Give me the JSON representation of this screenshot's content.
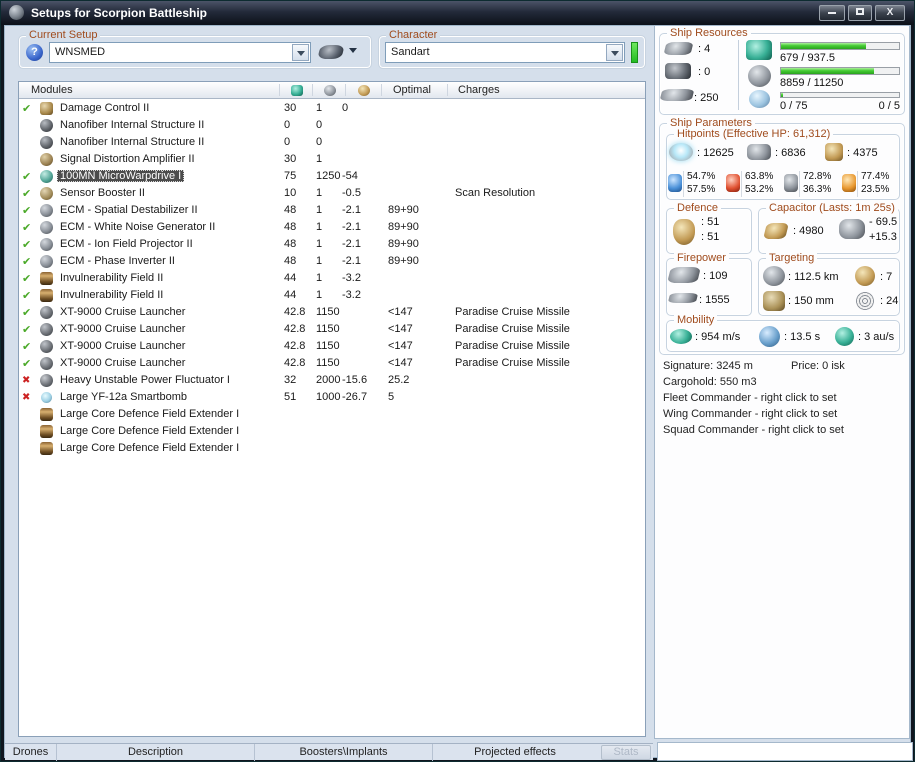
{
  "window": {
    "title": "Setups for Scorpion Battleship",
    "close_label": "X"
  },
  "current_setup": {
    "label": "Current Setup",
    "value": "WNSMED"
  },
  "character": {
    "label": "Character",
    "value": "Sandart"
  },
  "modules": {
    "header": {
      "name": "Modules",
      "optimal": "Optimal",
      "charges": "Charges"
    },
    "rows": [
      {
        "status": "ok",
        "icon": "damage-control",
        "name": "Damage Control II",
        "cpu": "30",
        "pg": "1",
        "cap": "0",
        "optimal": "",
        "charges": "",
        "sel": ""
      },
      {
        "status": "none",
        "icon": "nanofiber",
        "name": "Nanofiber Internal Structure II",
        "cpu": "0",
        "pg": "0",
        "cap": "",
        "optimal": "",
        "charges": "",
        "sel": ""
      },
      {
        "status": "none",
        "icon": "nanofiber",
        "name": "Nanofiber Internal Structure II",
        "cpu": "0",
        "pg": "0",
        "cap": "",
        "optimal": "",
        "charges": "",
        "sel": ""
      },
      {
        "status": "none",
        "icon": "signal-distortion-amplifier",
        "name": "Signal Distortion Amplifier II",
        "cpu": "30",
        "pg": "1",
        "cap": "",
        "optimal": "",
        "charges": "",
        "sel": ""
      },
      {
        "status": "ok",
        "icon": "microwarpdrive",
        "name": "100MN MicroWarpdrive I",
        "cpu": "75",
        "pg": "1250",
        "cap": "-54",
        "optimal": "",
        "charges": "",
        "sel": "selected"
      },
      {
        "status": "ok",
        "icon": "sensor-booster",
        "name": "Sensor Booster II",
        "cpu": "10",
        "pg": "1",
        "cap": "-0.5",
        "optimal": "",
        "charges": "Scan Resolution",
        "sel": ""
      },
      {
        "status": "ok",
        "icon": "ecm",
        "name": "ECM - Spatial Destabilizer II",
        "cpu": "48",
        "pg": "1",
        "cap": "-2.1",
        "optimal": "89+90",
        "charges": "",
        "sel": ""
      },
      {
        "status": "ok",
        "icon": "ecm",
        "name": "ECM - White Noise Generator II",
        "cpu": "48",
        "pg": "1",
        "cap": "-2.1",
        "optimal": "89+90",
        "charges": "",
        "sel": ""
      },
      {
        "status": "ok",
        "icon": "ecm",
        "name": "ECM - Ion Field Projector II",
        "cpu": "48",
        "pg": "1",
        "cap": "-2.1",
        "optimal": "89+90",
        "charges": "",
        "sel": ""
      },
      {
        "status": "ok",
        "icon": "ecm",
        "name": "ECM - Phase Inverter II",
        "cpu": "48",
        "pg": "1",
        "cap": "-2.1",
        "optimal": "89+90",
        "charges": "",
        "sel": ""
      },
      {
        "status": "ok",
        "icon": "invulnerability-field",
        "name": "Invulnerability Field II",
        "cpu": "44",
        "pg": "1",
        "cap": "-3.2",
        "optimal": "",
        "charges": "",
        "sel": ""
      },
      {
        "status": "ok",
        "icon": "invulnerability-field",
        "name": "Invulnerability Field II",
        "cpu": "44",
        "pg": "1",
        "cap": "-3.2",
        "optimal": "",
        "charges": "",
        "sel": ""
      },
      {
        "status": "ok",
        "icon": "cruise-launcher",
        "name": "XT-9000 Cruise Launcher",
        "cpu": "42.8",
        "pg": "1150",
        "cap": "",
        "optimal": "<147",
        "charges": "Paradise Cruise Missile",
        "sel": ""
      },
      {
        "status": "ok",
        "icon": "cruise-launcher",
        "name": "XT-9000 Cruise Launcher",
        "cpu": "42.8",
        "pg": "1150",
        "cap": "",
        "optimal": "<147",
        "charges": "Paradise Cruise Missile",
        "sel": ""
      },
      {
        "status": "ok",
        "icon": "cruise-launcher",
        "name": "XT-9000 Cruise Launcher",
        "cpu": "42.8",
        "pg": "1150",
        "cap": "",
        "optimal": "<147",
        "charges": "Paradise Cruise Missile",
        "sel": ""
      },
      {
        "status": "ok",
        "icon": "cruise-launcher",
        "name": "XT-9000 Cruise Launcher",
        "cpu": "42.8",
        "pg": "1150",
        "cap": "",
        "optimal": "<147",
        "charges": "Paradise Cruise Missile",
        "sel": ""
      },
      {
        "status": "off",
        "icon": "power-fluctuator",
        "name": "Heavy Unstable Power Fluctuator I",
        "cpu": "32",
        "pg": "2000",
        "cap": "-15.6",
        "optimal": "25.2",
        "charges": "",
        "sel": ""
      },
      {
        "status": "off",
        "icon": "smartbomb",
        "name": "Large YF-12a Smartbomb",
        "cpu": "51",
        "pg": "1000",
        "cap": "-26.7",
        "optimal": "5",
        "charges": "",
        "sel": ""
      },
      {
        "status": "none",
        "icon": "rig",
        "name": "Large Core Defence Field Extender I",
        "cpu": "",
        "pg": "",
        "cap": "",
        "optimal": "",
        "charges": "",
        "sel": ""
      },
      {
        "status": "none",
        "icon": "rig",
        "name": "Large Core Defence Field Extender I",
        "cpu": "",
        "pg": "",
        "cap": "",
        "optimal": "",
        "charges": "",
        "sel": ""
      },
      {
        "status": "none",
        "icon": "rig",
        "name": "Large Core Defence Field Extender I",
        "cpu": "",
        "pg": "",
        "cap": "",
        "optimal": "",
        "charges": "",
        "sel": ""
      }
    ]
  },
  "ship_resources": {
    "label": "Ship Resources",
    "turrets": ": 4",
    "launchers": ": 0",
    "calibration": ": 250",
    "cpu": {
      "text": "679 / 937.5",
      "pct": 72.4
    },
    "powergrid": {
      "text": "8859 / 11250",
      "pct": 78.7
    },
    "drones": {
      "text": "0 / 75",
      "right": "0 / 5",
      "pct": 2
    }
  },
  "ship_parameters": {
    "label": "Ship Parameters",
    "hitpoints": {
      "label": "Hitpoints (Effective HP: 61,312)",
      "shield": ": 12625",
      "armor": ": 6836",
      "structure": ": 4375",
      "resists": [
        {
          "type": "em",
          "shield": "54.7%",
          "armor": "57.5%"
        },
        {
          "type": "thermal",
          "shield": "63.8%",
          "armor": "53.2%"
        },
        {
          "type": "kinetic",
          "shield": "72.8%",
          "armor": "36.3%"
        },
        {
          "type": "explosive",
          "shield": "77.4%",
          "armor": "23.5%"
        }
      ]
    },
    "defence": {
      "label": "Defence",
      "shield": ": 51",
      "armor": ": 51"
    },
    "capacitor": {
      "label": "Capacitor (Lasts: 1m 25s)",
      "amount": ": 4980",
      "drain": "- 69.5",
      "recharge": "+15.3"
    },
    "firepower": {
      "label": "Firepower",
      "dps": ": 109",
      "volley": ": 1555"
    },
    "targeting": {
      "label": "Targeting",
      "range": ": 112.5 km",
      "max_targets": ": 7",
      "scan_resolution": ": 150 mm",
      "sensor_strength": ": 24"
    },
    "mobility": {
      "label": "Mobility",
      "speed": ": 954 m/s",
      "align_time": ": 13.5 s",
      "warp_speed": ": 3 au/s"
    }
  },
  "info": {
    "signature": "Signature: 3245 m",
    "price": "Price: 0 isk",
    "cargohold": "Cargohold: 550 m3",
    "fleet": "Fleet Commander - right click to set",
    "wing": "Wing Commander - right click to set",
    "squad": "Squad Commander - right click to set"
  },
  "tabs": [
    "Drones",
    "Description",
    "Boosters\\Implants",
    "Projected effects"
  ],
  "stats_button": "Stats",
  "colors": {
    "accent_green": "#2eb82e",
    "label_red": "#a04c1e",
    "selection": "#4c4c4c"
  }
}
